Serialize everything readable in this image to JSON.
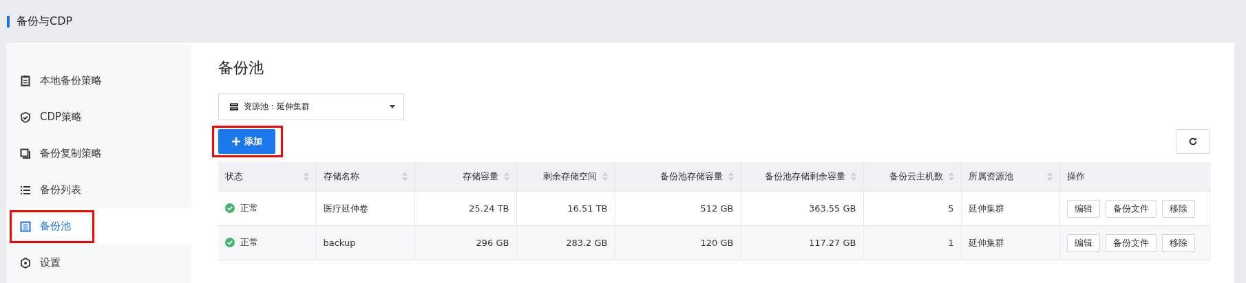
{
  "header": {
    "title": "备份与CDP"
  },
  "sidebar": {
    "items": [
      {
        "label": "本地备份策略",
        "selected": false,
        "highlighted": false
      },
      {
        "label": "CDP策略",
        "selected": false,
        "highlighted": false
      },
      {
        "label": "备份复制策略",
        "selected": false,
        "highlighted": false
      },
      {
        "label": "备份列表",
        "selected": false,
        "highlighted": false
      },
      {
        "label": "备份池",
        "selected": true,
        "highlighted": true
      },
      {
        "label": "设置",
        "selected": false,
        "highlighted": false
      }
    ]
  },
  "page_title": "备份池",
  "pool_select": {
    "value": "资源池：延伸集群"
  },
  "add_button": {
    "label": "添加",
    "highlighted": true
  },
  "table": {
    "columns": [
      {
        "label": "状态",
        "sortable": true
      },
      {
        "label": "存储名称",
        "sortable": true
      },
      {
        "label": "存储容量",
        "sortable": true
      },
      {
        "label": "剩余存储空间",
        "sortable": true
      },
      {
        "label": "备份池存储容量",
        "sortable": true
      },
      {
        "label": "备份池存储剩余容量",
        "sortable": true
      },
      {
        "label": "备份云主机数",
        "sortable": true
      },
      {
        "label": "所属资源池",
        "sortable": true
      },
      {
        "label": "操作",
        "sortable": false
      }
    ],
    "rows": [
      {
        "cells": [
          "正常",
          "医疗延伸卷",
          "25.24 TB",
          "16.51 TB",
          "512 GB",
          "363.55 GB",
          "5",
          "延伸集群"
        ],
        "actions": [
          "编辑",
          "备份文件",
          "移除"
        ]
      },
      {
        "cells": [
          "正常",
          "backup",
          "296 GB",
          "283.2 GB",
          "120 GB",
          "117.27 GB",
          "1",
          "延伸集群"
        ],
        "actions": [
          "编辑",
          "备份文件",
          "移除"
        ]
      }
    ]
  }
}
